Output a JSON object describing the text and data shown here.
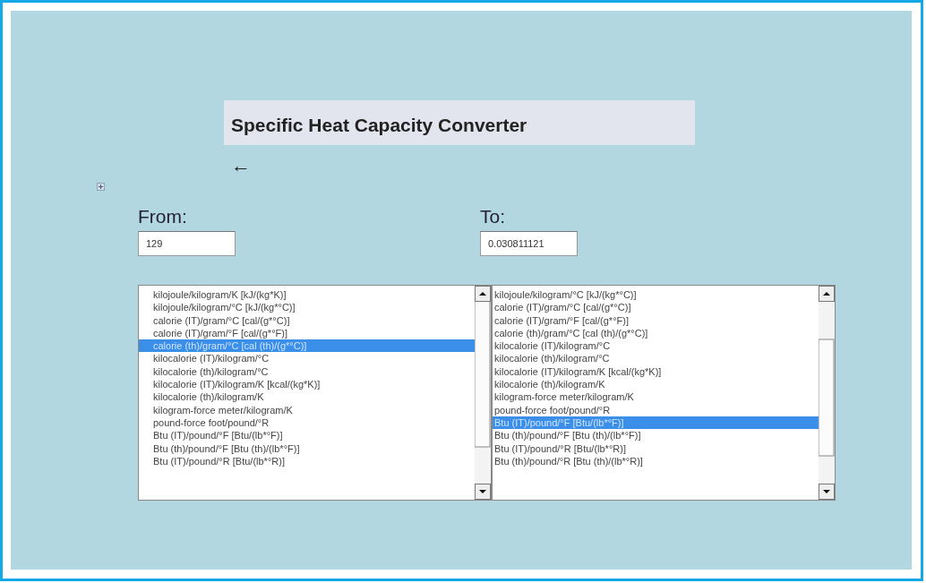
{
  "title": "Specific Heat Capacity Converter",
  "back": {
    "symbol": "←"
  },
  "from": {
    "label": "From:",
    "value": "129"
  },
  "to": {
    "label": "To:",
    "value": "0.030811121"
  },
  "lists": [
    {
      "items": [
        {
          "label": "kilojoule/kilogram/K [kJ/(kg*K)]",
          "selected": false
        },
        {
          "label": "kilojoule/kilogram/°C [kJ/(kg*°C)]",
          "selected": false
        },
        {
          "label": "calorie (IT)/gram/°C [cal/(g*°C)]",
          "selected": false
        },
        {
          "label": "calorie (IT)/gram/°F [cal/(g*°F)]",
          "selected": false
        },
        {
          "label": "calorie (th)/gram/°C [cal (th)/(g*°C)]",
          "selected": true
        },
        {
          "label": "kilocalorie (IT)/kilogram/°C",
          "selected": false
        },
        {
          "label": "kilocalorie (th)/kilogram/°C",
          "selected": false
        },
        {
          "label": "kilocalorie (IT)/kilogram/K [kcal/(kg*K)]",
          "selected": false
        },
        {
          "label": "kilocalorie (th)/kilogram/K",
          "selected": false
        },
        {
          "label": "kilogram-force meter/kilogram/K",
          "selected": false
        },
        {
          "label": "pound-force foot/pound/°R",
          "selected": false
        },
        {
          "label": "Btu (IT)/pound/°F [Btu/(lb*°F)]",
          "selected": false
        },
        {
          "label": "Btu (th)/pound/°F [Btu (th)/(lb*°F)]",
          "selected": false
        },
        {
          "label": "Btu (IT)/pound/°R [Btu/(lb*°R)]",
          "selected": false
        }
      ]
    },
    {
      "items": [
        {
          "label": "kilojoule/kilogram/°C [kJ/(kg*°C)]",
          "selected": false
        },
        {
          "label": "calorie (IT)/gram/°C [cal/(g*°C)]",
          "selected": false
        },
        {
          "label": "calorie (IT)/gram/°F [cal/(g*°F)]",
          "selected": false
        },
        {
          "label": "calorie (th)/gram/°C [cal (th)/(g*°C)]",
          "selected": false
        },
        {
          "label": "kilocalorie (IT)/kilogram/°C",
          "selected": false
        },
        {
          "label": "kilocalorie (th)/kilogram/°C",
          "selected": false
        },
        {
          "label": "kilocalorie (IT)/kilogram/K [kcal/(kg*K)]",
          "selected": false
        },
        {
          "label": "kilocalorie (th)/kilogram/K",
          "selected": false
        },
        {
          "label": "kilogram-force meter/kilogram/K",
          "selected": false
        },
        {
          "label": "pound-force foot/pound/°R",
          "selected": false
        },
        {
          "label": "Btu (IT)/pound/°F [Btu/(lb*°F)]",
          "selected": true
        },
        {
          "label": "Btu (th)/pound/°F [Btu (th)/(lb*°F)]",
          "selected": false
        },
        {
          "label": "Btu (IT)/pound/°R [Btu/(lb*°R)]",
          "selected": false
        },
        {
          "label": "Btu (th)/pound/°R [Btu (th)/(lb*°R)]",
          "selected": false
        }
      ]
    }
  ]
}
